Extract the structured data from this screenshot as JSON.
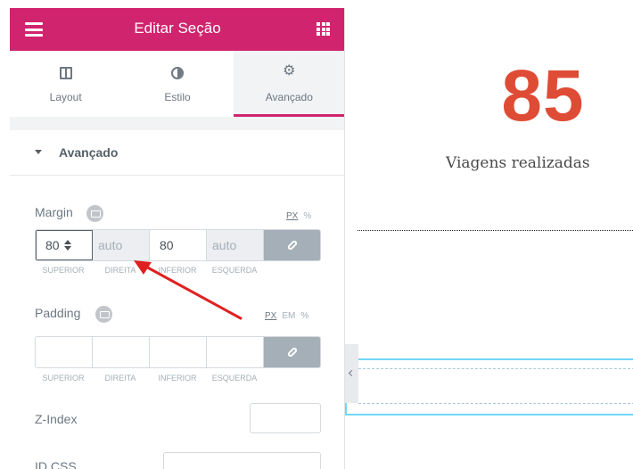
{
  "header": {
    "title": "Editar Seção"
  },
  "tabs": [
    {
      "label": "Layout",
      "icon": "layout-icon"
    },
    {
      "label": "Estilo",
      "icon": "style-icon"
    },
    {
      "label": "Avançado",
      "icon": "gear-icon",
      "active": true
    }
  ],
  "section": {
    "title": "Avançado"
  },
  "margin": {
    "label": "Margin",
    "units": [
      "PX",
      "%"
    ],
    "selected_unit": "PX",
    "values": {
      "top": "80",
      "right": "auto",
      "bottom": "80",
      "left": "auto"
    },
    "side_labels": [
      "SUPERIOR",
      "DIREITA",
      "INFERIOR",
      "ESQUERDA"
    ]
  },
  "padding": {
    "label": "Padding",
    "units": [
      "PX",
      "EM",
      "%"
    ],
    "selected_unit": "PX",
    "values": {
      "top": "",
      "right": "",
      "bottom": "",
      "left": ""
    },
    "side_labels": [
      "SUPERIOR",
      "DIREITA",
      "INFERIOR",
      "ESQUERDA"
    ]
  },
  "zindex": {
    "label": "Z-Index",
    "value": ""
  },
  "css_id": {
    "label": "ID CSS",
    "value": ""
  },
  "canvas": {
    "counter_value": "85",
    "counter_title": "Viagens realizadas"
  },
  "colors": {
    "accent": "#d1246e",
    "counter": "#df4c36",
    "section_outline": "#71d7f7",
    "annotation_arrow": "#e02020"
  }
}
